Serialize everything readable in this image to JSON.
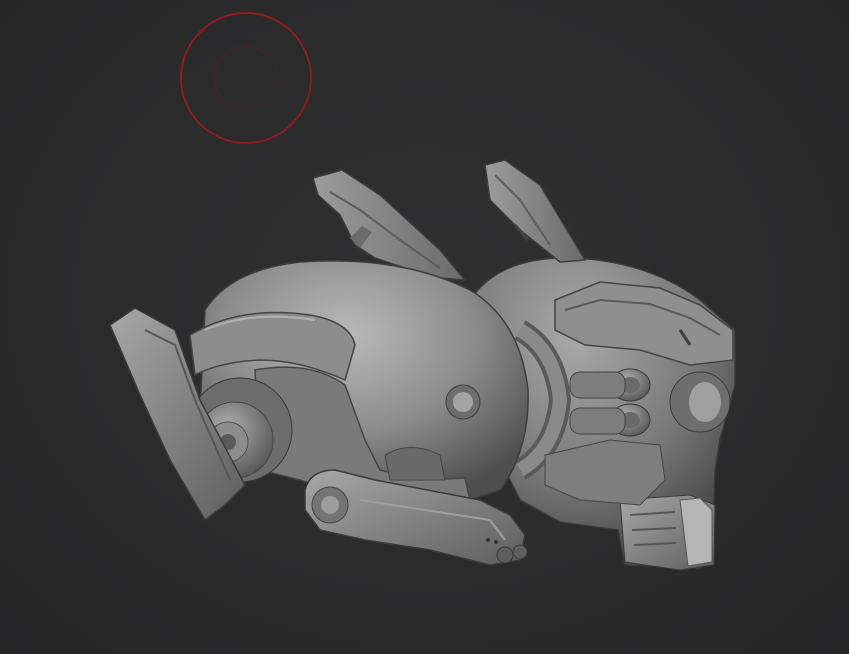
{
  "viewport": {
    "background": "#2b2b2c"
  },
  "brush_cursor": {
    "color": "#8a1f24",
    "icon": "sculpt-brush-circle-icon"
  },
  "model": {
    "material_color": "#8e8e8e",
    "icon": "robot-helmet-sculpt"
  }
}
